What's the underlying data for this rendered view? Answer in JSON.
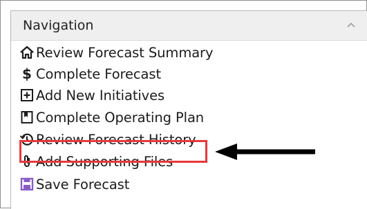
{
  "panel": {
    "title": "Navigation",
    "collapse_icon": "chevron-up-icon"
  },
  "nav_items": [
    {
      "label": "Review Forecast Summary",
      "icon": "home-icon"
    },
    {
      "label": "Complete Forecast",
      "icon": "dollar-icon"
    },
    {
      "label": "Add New Initiatives",
      "icon": "plus-box-icon"
    },
    {
      "label": "Complete Operating Plan",
      "icon": "bookmark-icon"
    },
    {
      "label": "Review Forecast History",
      "icon": "history-icon"
    },
    {
      "label": "Add Supporting Files",
      "icon": "paperclip-icon"
    },
    {
      "label": "Save Forecast",
      "icon": "floppy-disk-icon"
    }
  ],
  "annotation": {
    "highlighted_item": "Add Supporting Files",
    "highlight_color": "#e8383a",
    "arrow_color": "#000000"
  },
  "colors": {
    "save_icon": "#8a5cc7",
    "text": "#1b1b1b",
    "header_bg": "#efefef"
  }
}
